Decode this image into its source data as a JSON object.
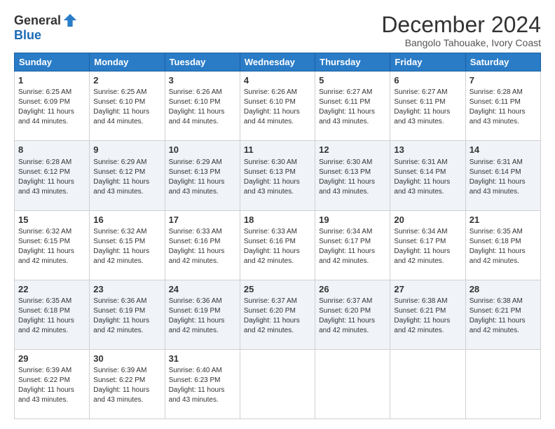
{
  "logo": {
    "general": "General",
    "blue": "Blue"
  },
  "title": "December 2024",
  "location": "Bangolo Tahouake, Ivory Coast",
  "days_header": [
    "Sunday",
    "Monday",
    "Tuesday",
    "Wednesday",
    "Thursday",
    "Friday",
    "Saturday"
  ],
  "weeks": [
    [
      {
        "day": "1",
        "sunrise": "6:25 AM",
        "sunset": "6:09 PM",
        "daylight": "11 hours and 44 minutes."
      },
      {
        "day": "2",
        "sunrise": "6:25 AM",
        "sunset": "6:10 PM",
        "daylight": "11 hours and 44 minutes."
      },
      {
        "day": "3",
        "sunrise": "6:26 AM",
        "sunset": "6:10 PM",
        "daylight": "11 hours and 44 minutes."
      },
      {
        "day": "4",
        "sunrise": "6:26 AM",
        "sunset": "6:10 PM",
        "daylight": "11 hours and 44 minutes."
      },
      {
        "day": "5",
        "sunrise": "6:27 AM",
        "sunset": "6:11 PM",
        "daylight": "11 hours and 43 minutes."
      },
      {
        "day": "6",
        "sunrise": "6:27 AM",
        "sunset": "6:11 PM",
        "daylight": "11 hours and 43 minutes."
      },
      {
        "day": "7",
        "sunrise": "6:28 AM",
        "sunset": "6:11 PM",
        "daylight": "11 hours and 43 minutes."
      }
    ],
    [
      {
        "day": "8",
        "sunrise": "6:28 AM",
        "sunset": "6:12 PM",
        "daylight": "11 hours and 43 minutes."
      },
      {
        "day": "9",
        "sunrise": "6:29 AM",
        "sunset": "6:12 PM",
        "daylight": "11 hours and 43 minutes."
      },
      {
        "day": "10",
        "sunrise": "6:29 AM",
        "sunset": "6:13 PM",
        "daylight": "11 hours and 43 minutes."
      },
      {
        "day": "11",
        "sunrise": "6:30 AM",
        "sunset": "6:13 PM",
        "daylight": "11 hours and 43 minutes."
      },
      {
        "day": "12",
        "sunrise": "6:30 AM",
        "sunset": "6:13 PM",
        "daylight": "11 hours and 43 minutes."
      },
      {
        "day": "13",
        "sunrise": "6:31 AM",
        "sunset": "6:14 PM",
        "daylight": "11 hours and 43 minutes."
      },
      {
        "day": "14",
        "sunrise": "6:31 AM",
        "sunset": "6:14 PM",
        "daylight": "11 hours and 43 minutes."
      }
    ],
    [
      {
        "day": "15",
        "sunrise": "6:32 AM",
        "sunset": "6:15 PM",
        "daylight": "11 hours and 42 minutes."
      },
      {
        "day": "16",
        "sunrise": "6:32 AM",
        "sunset": "6:15 PM",
        "daylight": "11 hours and 42 minutes."
      },
      {
        "day": "17",
        "sunrise": "6:33 AM",
        "sunset": "6:16 PM",
        "daylight": "11 hours and 42 minutes."
      },
      {
        "day": "18",
        "sunrise": "6:33 AM",
        "sunset": "6:16 PM",
        "daylight": "11 hours and 42 minutes."
      },
      {
        "day": "19",
        "sunrise": "6:34 AM",
        "sunset": "6:17 PM",
        "daylight": "11 hours and 42 minutes."
      },
      {
        "day": "20",
        "sunrise": "6:34 AM",
        "sunset": "6:17 PM",
        "daylight": "11 hours and 42 minutes."
      },
      {
        "day": "21",
        "sunrise": "6:35 AM",
        "sunset": "6:18 PM",
        "daylight": "11 hours and 42 minutes."
      }
    ],
    [
      {
        "day": "22",
        "sunrise": "6:35 AM",
        "sunset": "6:18 PM",
        "daylight": "11 hours and 42 minutes."
      },
      {
        "day": "23",
        "sunrise": "6:36 AM",
        "sunset": "6:19 PM",
        "daylight": "11 hours and 42 minutes."
      },
      {
        "day": "24",
        "sunrise": "6:36 AM",
        "sunset": "6:19 PM",
        "daylight": "11 hours and 42 minutes."
      },
      {
        "day": "25",
        "sunrise": "6:37 AM",
        "sunset": "6:20 PM",
        "daylight": "11 hours and 42 minutes."
      },
      {
        "day": "26",
        "sunrise": "6:37 AM",
        "sunset": "6:20 PM",
        "daylight": "11 hours and 42 minutes."
      },
      {
        "day": "27",
        "sunrise": "6:38 AM",
        "sunset": "6:21 PM",
        "daylight": "11 hours and 42 minutes."
      },
      {
        "day": "28",
        "sunrise": "6:38 AM",
        "sunset": "6:21 PM",
        "daylight": "11 hours and 42 minutes."
      }
    ],
    [
      {
        "day": "29",
        "sunrise": "6:39 AM",
        "sunset": "6:22 PM",
        "daylight": "11 hours and 43 minutes."
      },
      {
        "day": "30",
        "sunrise": "6:39 AM",
        "sunset": "6:22 PM",
        "daylight": "11 hours and 43 minutes."
      },
      {
        "day": "31",
        "sunrise": "6:40 AM",
        "sunset": "6:23 PM",
        "daylight": "11 hours and 43 minutes."
      },
      null,
      null,
      null,
      null
    ]
  ]
}
